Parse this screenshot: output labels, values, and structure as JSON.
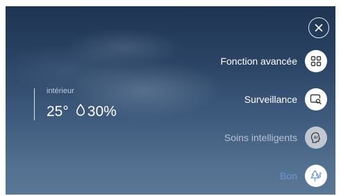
{
  "indoor": {
    "label": "intérieur",
    "temperature": "25°",
    "humidity": "30%"
  },
  "menu": [
    {
      "label": "Fonction avancée",
      "icon": "grid-icon",
      "state": "active"
    },
    {
      "label": "Surveillance",
      "icon": "monitor-search-icon",
      "state": "active"
    },
    {
      "label": "Soins intelligents",
      "icon": "ai-care-icon",
      "state": "disabled"
    },
    {
      "label": "Bon",
      "icon": "tree-icon",
      "state": "highlight"
    }
  ],
  "colors": {
    "label_active": "#ffffff",
    "label_disabled": "#b7c1ce",
    "label_highlight": "#6f98d6",
    "icon_stroke": "#3a3a3a"
  }
}
